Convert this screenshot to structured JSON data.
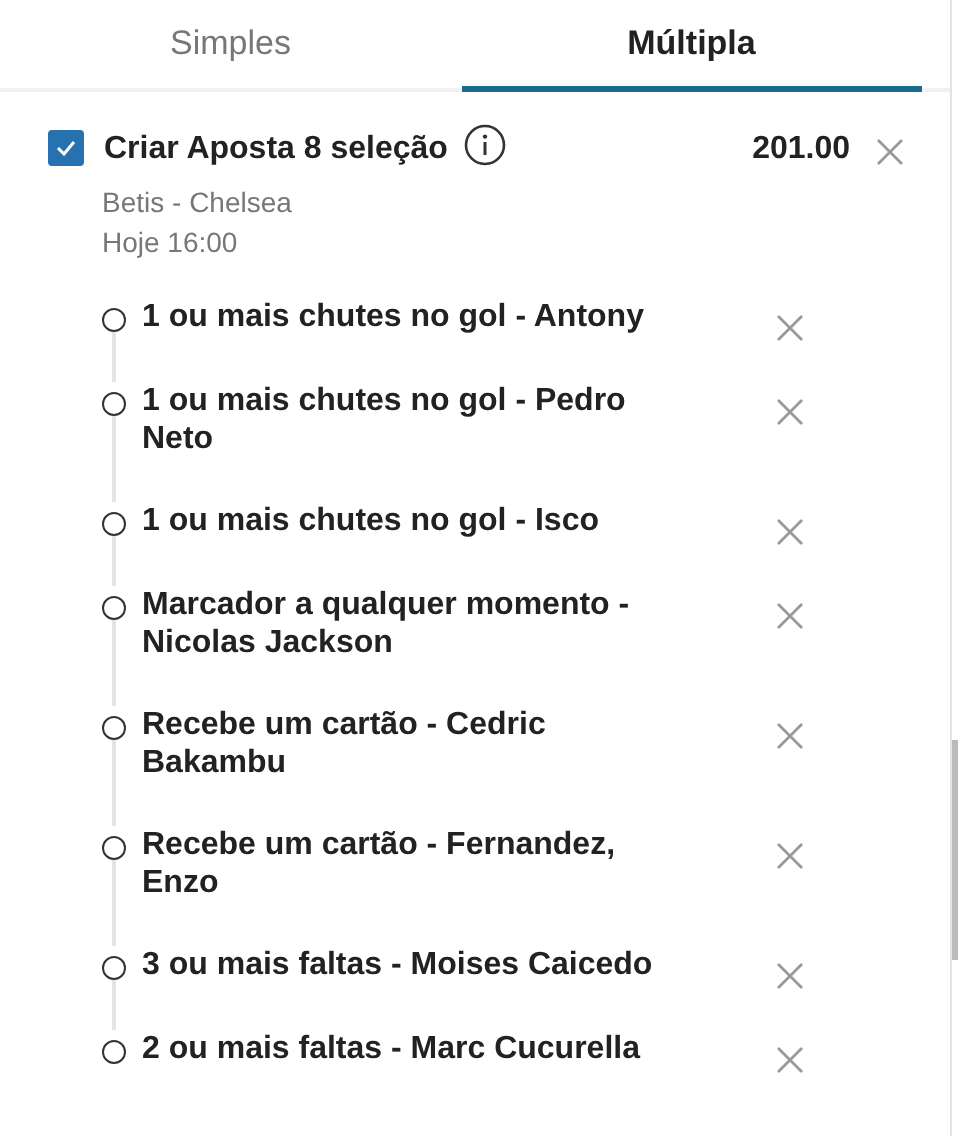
{
  "tabs": [
    {
      "label": "Simples",
      "selected": false
    },
    {
      "label": "Múltipla",
      "selected": true
    }
  ],
  "bet": {
    "checked": true,
    "title": "Criar Aposta 8 seleção",
    "odds": "201.00",
    "match": "Betis - Chelsea",
    "time": "Hoje 16:00",
    "selections": [
      {
        "label": "1 ou mais chutes no gol - Antony"
      },
      {
        "label": "1 ou mais chutes no gol - Pedro Neto"
      },
      {
        "label": "1 ou mais chutes no gol - Isco"
      },
      {
        "label": "Marcador a qualquer momento - Nicolas Jackson"
      },
      {
        "label": "Recebe um cartão - Cedric Bakambu"
      },
      {
        "label": "Recebe um cartão - Fernandez, Enzo"
      },
      {
        "label": "3 ou mais faltas - Moises Caicedo"
      },
      {
        "label": "2 ou mais faltas - Marc Cucurella"
      }
    ]
  }
}
